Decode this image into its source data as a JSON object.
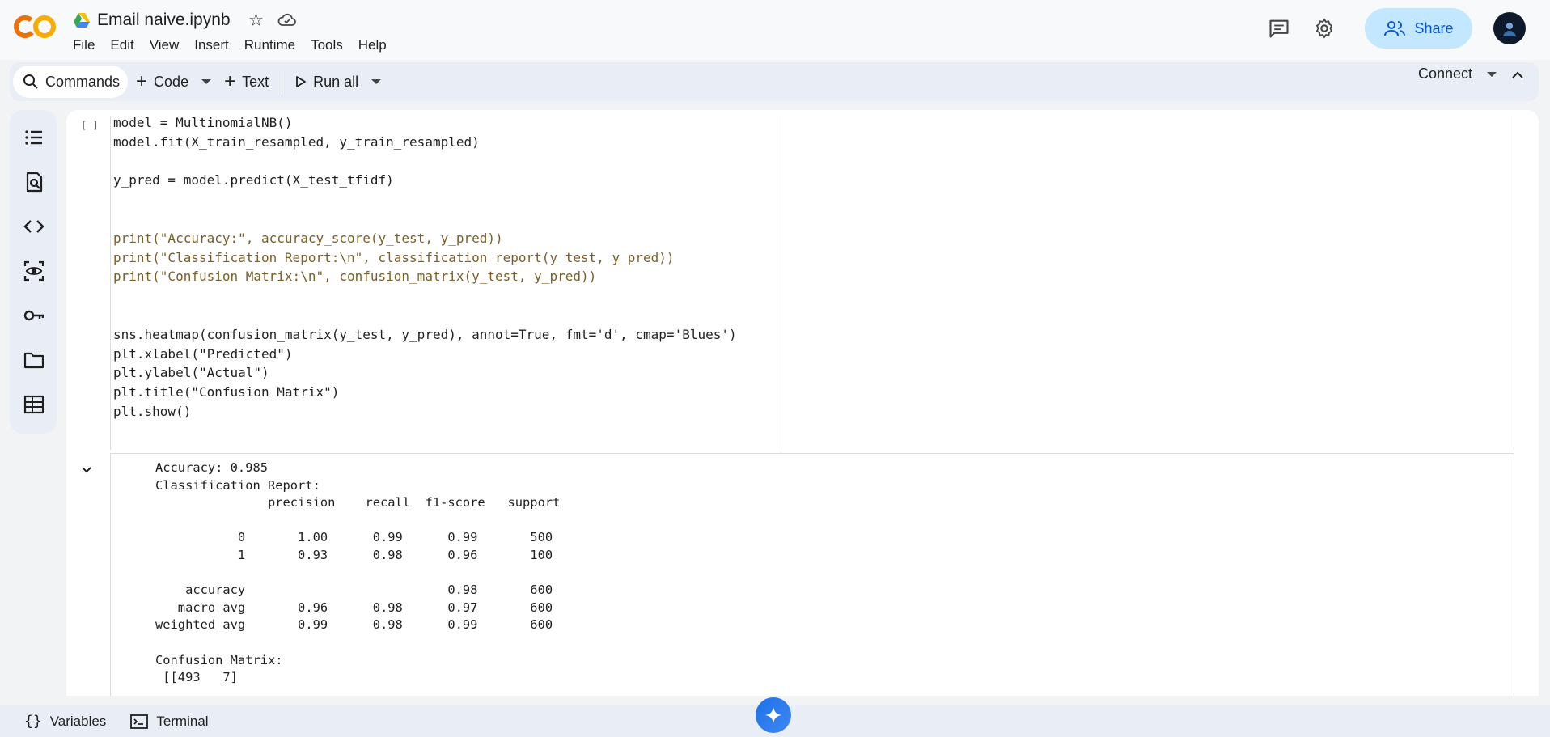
{
  "app": {
    "logo": "colab-logo",
    "doc_title": "Email naive.ipynb",
    "menu": [
      "File",
      "Edit",
      "View",
      "Insert",
      "Runtime",
      "Tools",
      "Help"
    ],
    "share_label": "Share",
    "colors": {
      "share_bg": "#c2e7ff",
      "share_text": "#0b57d0",
      "logo_orange": "#f9ab00",
      "logo_dark": "#e8710a"
    }
  },
  "toolbar": {
    "commands": "Commands",
    "code": "Code",
    "text": "Text",
    "run_all": "Run all",
    "connect": "Connect"
  },
  "rail": {
    "icons": [
      "table-of-contents-icon",
      "find-icon",
      "code-snippets-icon",
      "variables-inspector-icon",
      "secrets-key-icon",
      "files-folder-icon",
      "data-table-icon"
    ]
  },
  "cell": {
    "execution_bracket": "[ ]",
    "code_lines": [
      "model = MultinomialNB()",
      "model.fit(X_train_resampled, y_train_resampled)",
      "",
      "y_pred = model.predict(X_test_tfidf)",
      "",
      "",
      "print(\"Accuracy:\", accuracy_score(y_test, y_pred))",
      "print(\"Classification Report:\\n\", classification_report(y_test, y_pred))",
      "print(\"Confusion Matrix:\\n\", confusion_matrix(y_test, y_pred))",
      "",
      "",
      "sns.heatmap(confusion_matrix(y_test, y_pred), annot=True, fmt='d', cmap='Blues')",
      "plt.xlabel(\"Predicted\")",
      "plt.ylabel(\"Actual\")",
      "plt.title(\"Confusion Matrix\")",
      "plt.show()"
    ],
    "output_lines": [
      "Accuracy: 0.985",
      "Classification Report:",
      "               precision    recall  f1-score   support",
      "",
      "           0       1.00      0.99      0.99       500",
      "           1       0.93      0.98      0.96       100",
      "",
      "    accuracy                           0.98       600",
      "   macro avg       0.96      0.98      0.97       600",
      "weighted avg       0.99      0.98      0.99       600",
      "",
      "Confusion Matrix:",
      " [[493   7]"
    ]
  },
  "bottom": {
    "variables": "Variables",
    "terminal": "Terminal"
  }
}
